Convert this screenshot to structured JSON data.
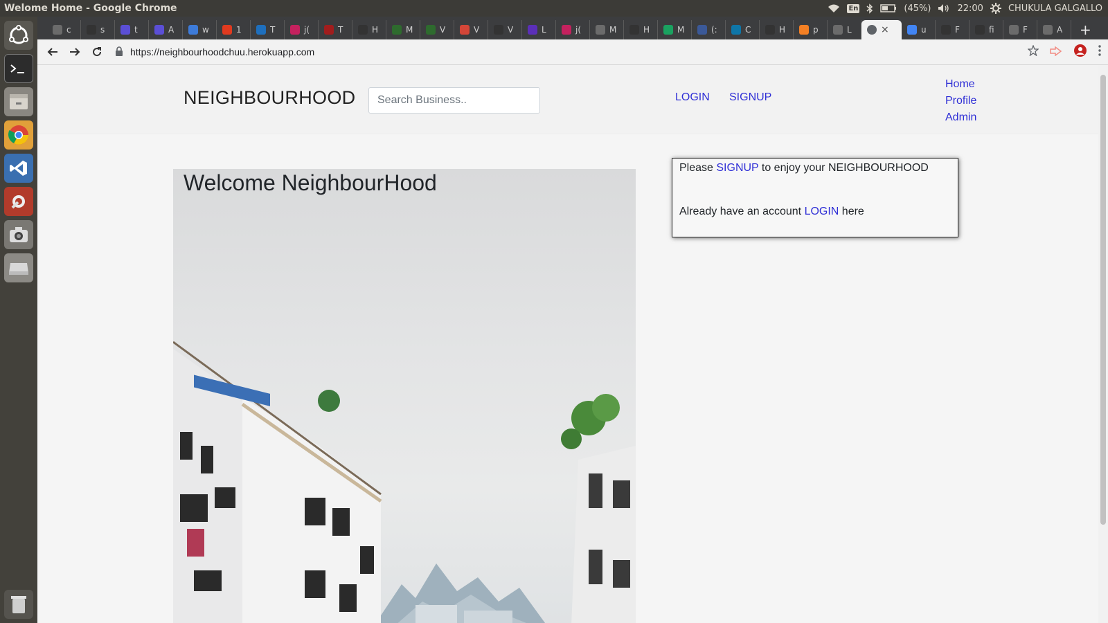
{
  "system": {
    "window_title": "Welome Home - Google Chrome",
    "battery": "(45%)",
    "language": "En",
    "time": "22:00",
    "user": "CHUKULA GALGALLO"
  },
  "launcher": {
    "icons": [
      "ubuntu-dash-icon",
      "terminal-icon",
      "files-icon",
      "chrome-icon",
      "vscode-icon",
      "settings-icon",
      "camera-icon",
      "drive-icon"
    ]
  },
  "tabs": [
    {
      "letter": "c",
      "color": "#6b6b6b"
    },
    {
      "letter": "s",
      "color": "#333333"
    },
    {
      "letter": "t",
      "color": "#5b4fd6"
    },
    {
      "letter": "A",
      "color": "#5b4fd6"
    },
    {
      "letter": "w",
      "color": "#3d7bd9"
    },
    {
      "letter": "1",
      "color": "#e03a1f"
    },
    {
      "letter": "T",
      "color": "#1e6fbd"
    },
    {
      "letter": "j(",
      "color": "#c4215e"
    },
    {
      "letter": "T",
      "color": "#a11d1d"
    },
    {
      "letter": "H",
      "color": "#333333"
    },
    {
      "letter": "M",
      "color": "#2e6b2e"
    },
    {
      "letter": "V",
      "color": "#2e6b2e"
    },
    {
      "letter": "V",
      "color": "#d44638"
    },
    {
      "letter": "V",
      "color": "#333333"
    },
    {
      "letter": "L",
      "color": "#5b2fb8"
    },
    {
      "letter": "j(",
      "color": "#c4215e"
    },
    {
      "letter": "M",
      "color": "#6b6b6b"
    },
    {
      "letter": "H",
      "color": "#333333"
    },
    {
      "letter": "M",
      "color": "#1aa260"
    },
    {
      "letter": "(:",
      "color": "#3b5998"
    },
    {
      "letter": "C",
      "color": "#0e76a8"
    },
    {
      "letter": "H",
      "color": "#333333"
    },
    {
      "letter": "p",
      "color": "#f48024"
    },
    {
      "letter": "L",
      "color": "#6b6b6b"
    }
  ],
  "active_tab": {
    "close": "×"
  },
  "tabs_after": [
    {
      "letter": "u",
      "color": "#4285f4"
    },
    {
      "letter": "F",
      "color": "#333333"
    },
    {
      "letter": "fi",
      "color": "#333333"
    },
    {
      "letter": "F",
      "color": "#6b6b6b"
    },
    {
      "letter": "A",
      "color": "#6b6b6b"
    }
  ],
  "new_tab": "+",
  "address_bar": {
    "url": "https://neighbourhoodchuu.herokuapp.com"
  },
  "page": {
    "brand": "NEIGHBOURHOOD",
    "search_placeholder": "Search Business..",
    "nav": {
      "login": "LOGIN",
      "signup": "SIGNUP"
    },
    "side_nav": {
      "home": "Home",
      "profile": "Profile",
      "admin": "Admin"
    },
    "hero_title": "Welcome NeighbourHood",
    "info": {
      "line1_pre": "Please ",
      "line1_link": "SIGNUP",
      "line1_post": " to enjoy your NEIGHBOURHOOD",
      "line2_pre": "Already have an account ",
      "line2_link": "LOGIN",
      "line2_post": " here"
    }
  }
}
